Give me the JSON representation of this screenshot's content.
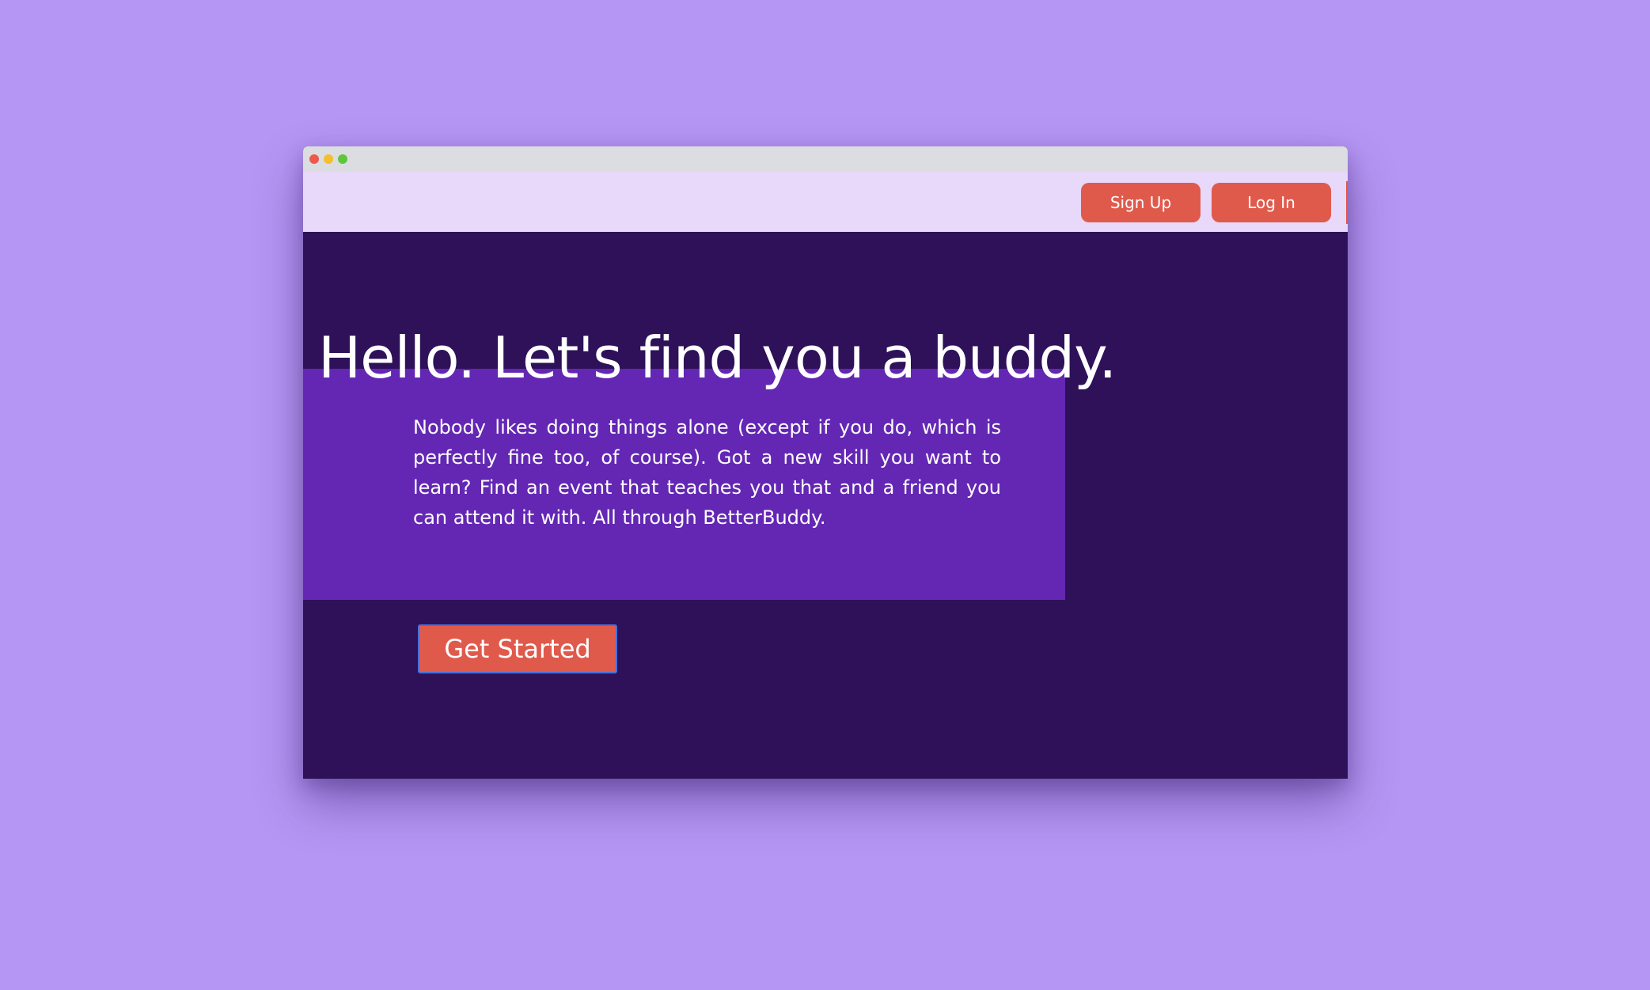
{
  "window": {
    "controls": [
      "close",
      "minimize",
      "maximize"
    ]
  },
  "nav": {
    "signup_label": "Sign Up",
    "login_label": "Log In"
  },
  "hero": {
    "title": "Hello. Let's find you a buddy.",
    "body": "Nobody likes doing things alone (except if you do, which is perfectly fine too, of course). Got a new skill you want to learn? Find an event that teaches you that and a friend you can attend it with. All through BetterBuddy.",
    "cta_label": "Get Started"
  },
  "colors": {
    "page_background": "#b596f4",
    "hero_background": "#2e1159",
    "hero_panel": "#6427b4",
    "navbar": "#e8d8fa",
    "button": "#e05a4c",
    "button_text": "#ffffff"
  }
}
